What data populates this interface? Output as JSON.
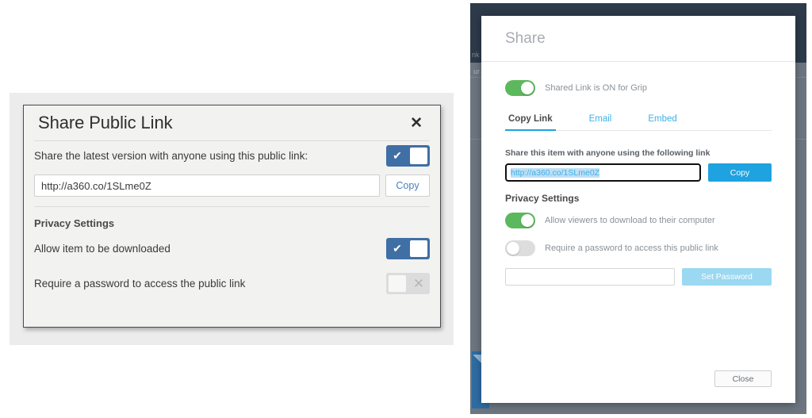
{
  "left_dialog": {
    "title": "Share Public Link",
    "close_glyph": "✕",
    "share_row_label": "Share the latest version with anyone using this public link:",
    "share_toggle_state": "on",
    "url_value": "http://a360.co/1SLme0Z",
    "url_placeholder": "",
    "copy_label": "Copy",
    "privacy_title": "Privacy Settings",
    "rows": [
      {
        "label": "Allow item to be downloaded",
        "state": "on"
      },
      {
        "label": "Require a password to access the public link",
        "state": "off"
      }
    ],
    "toggle_on_glyph": "✔",
    "toggle_off_glyph": "✕",
    "accent_on_color": "#3f6fa5",
    "accent_off_color": "#dcdcdc",
    "copy_link_color": "#4a7fbd"
  },
  "right_modal": {
    "title": "Share",
    "shared_link_toggle": {
      "label": "Shared Link is ON for Grip",
      "state": "on"
    },
    "tabs": [
      {
        "label": "Copy Link",
        "active": true
      },
      {
        "label": "Email",
        "active": false
      },
      {
        "label": "Embed",
        "active": false
      }
    ],
    "share_item_label": "Share this item with anyone using the following link",
    "url_value": "http://a360.co/1SLme0Z",
    "copy_label": "Copy",
    "privacy_title": "Privacy Settings",
    "privacy_rows": [
      {
        "label": "Allow viewers to download to their computer",
        "state": "on"
      },
      {
        "label": "Require a password to access this public link",
        "state": "off"
      }
    ],
    "password_value": "",
    "password_placeholder": "",
    "set_password_label": "Set Password",
    "close_label": "Close",
    "accent_color": "#1fa2e0",
    "link_color": "#3fb0e8",
    "toggle_on_color": "#5cb85c",
    "toggle_off_color": "#dddddd",
    "disabled_button_color": "#9bd8f2",
    "chrome_color": "#2d3a4a",
    "backdrop_color": "#6d7680",
    "thumbnail_glyph": "◥"
  }
}
